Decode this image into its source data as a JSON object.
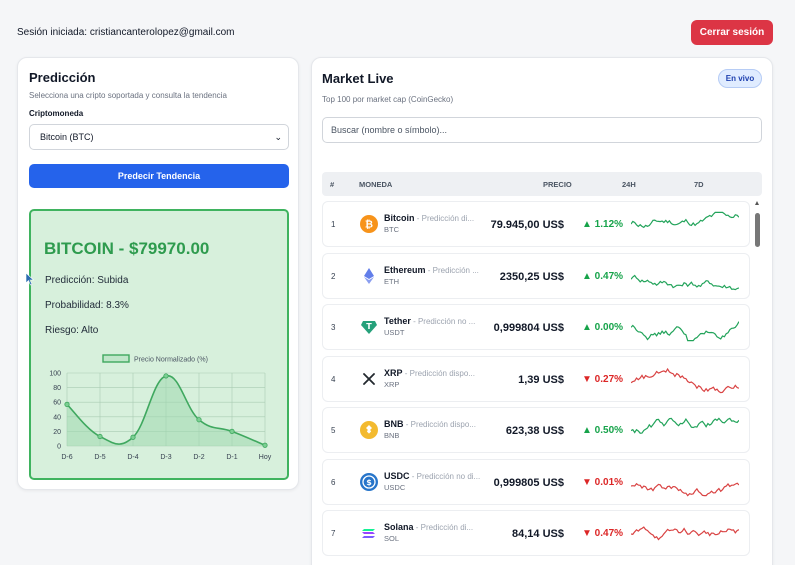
{
  "session": {
    "text": "Sesión iniciada: cristiancanterolopez@gmail.com",
    "logout_label": "Cerrar sesión"
  },
  "prediction": {
    "title": "Predicción",
    "subtitle": "Selecciona una cripto soportada y consulta la tendencia",
    "crypto_label": "Criptomoneda",
    "selected": "Bitcoin (BTC)",
    "button_label": "Predecir Tendencia",
    "result": {
      "coin_line": "BITCOIN - $79970.00",
      "prediction": "Predicción: Subida",
      "probability": "Probabilidad: 8.3%",
      "risk": "Riesgo: Alto"
    }
  },
  "chart_data": {
    "type": "line",
    "categories": [
      "D-6",
      "D-5",
      "D-4",
      "D-3",
      "D-2",
      "D-1",
      "Hoy"
    ],
    "series": [
      {
        "name": "Precio Normalizado (%)",
        "values": [
          57,
          13,
          12,
          96,
          36,
          20,
          1
        ]
      }
    ],
    "ylim": [
      0,
      100
    ],
    "yticks": [
      0,
      20,
      40,
      60,
      80,
      100
    ],
    "title": "",
    "xlabel": "",
    "ylabel": "",
    "legend": "top",
    "grid": true,
    "color": "#3fa85f"
  },
  "market": {
    "title": "Market Live",
    "subtitle": "Top 100 por market cap (CoinGecko)",
    "badge": "En vivo",
    "search_placeholder": "Buscar (nombre o símbolo)...",
    "columns": {
      "num": "#",
      "coin": "MONEDA",
      "price": "PRECIO",
      "h24": "24H",
      "d7": "7D"
    },
    "rows": [
      {
        "rank": "1",
        "name": "Bitcoin",
        "pred": " - Predicción di...",
        "symbol": "BTC",
        "price": "79.945,00 US$",
        "change": "▲ 1.12%",
        "dir": "up",
        "icon": "bitcoin-icon",
        "color": "#f7931a"
      },
      {
        "rank": "2",
        "name": "Ethereum",
        "pred": " - Predicción ...",
        "symbol": "ETH",
        "price": "2350,25 US$",
        "change": "▲ 0.47%",
        "dir": "up",
        "icon": "ethereum-icon",
        "color": "#627eea"
      },
      {
        "rank": "3",
        "name": "Tether",
        "pred": " - Predicción no ...",
        "symbol": "USDT",
        "price": "0,999804 US$",
        "change": "▲ 0.00%",
        "dir": "up",
        "icon": "tether-icon",
        "color": "#26a17b"
      },
      {
        "rank": "4",
        "name": "XRP",
        "pred": " - Predicción dispo...",
        "symbol": "XRP",
        "price": "1,39 US$",
        "change": "▼ 0.27%",
        "dir": "down",
        "icon": "xrp-icon",
        "color": "#23292f"
      },
      {
        "rank": "5",
        "name": "BNB",
        "pred": " - Predicción dispo...",
        "symbol": "BNB",
        "price": "623,38 US$",
        "change": "▲ 0.50%",
        "dir": "up",
        "icon": "bnb-icon",
        "color": "#f3ba2f"
      },
      {
        "rank": "6",
        "name": "USDC",
        "pred": " - Predicción no di...",
        "symbol": "USDC",
        "price": "0,999805 US$",
        "change": "▼ 0.01%",
        "dir": "down",
        "icon": "usdc-icon",
        "color": "#2775ca"
      },
      {
        "rank": "7",
        "name": "Solana",
        "pred": " - Predicción di...",
        "symbol": "SOL",
        "price": "84,14 US$",
        "change": "▼ 0.47%",
        "dir": "down",
        "icon": "solana-icon",
        "color": "#9945ff"
      }
    ]
  }
}
